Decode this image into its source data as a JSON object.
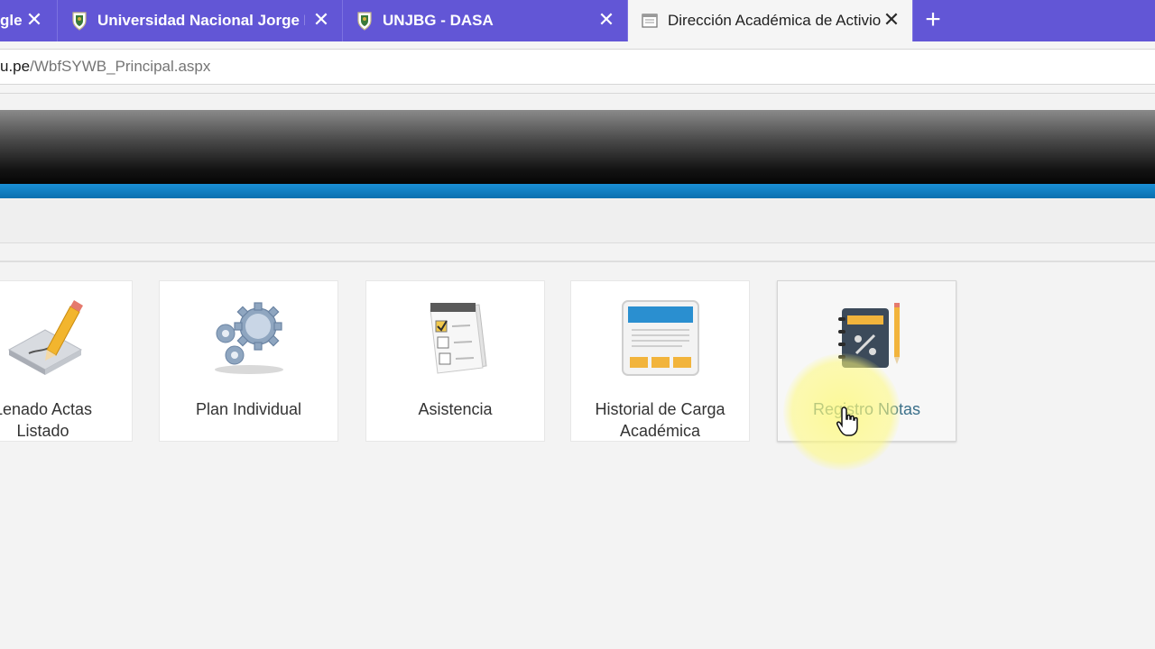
{
  "browser": {
    "tabs": [
      {
        "label": "gle",
        "favicon": "none",
        "active": false
      },
      {
        "label": "Universidad Nacional Jorge Bas",
        "favicon": "crest-icon",
        "active": false
      },
      {
        "label": "UNJBG - DASA",
        "favicon": "crest-icon",
        "active": false
      },
      {
        "label": "Dirección Académica de Activio",
        "favicon": "document-icon",
        "active": true
      }
    ],
    "new_tab_glyph": "+",
    "close_glyph": "✕",
    "url": {
      "host": "u.pe",
      "path": "/WbfSYWB_Principal.aspx"
    }
  },
  "tiles": [
    {
      "label_line1": "Lenado Actas",
      "label_line2": "Listado",
      "icon": "pencil-edit-icon"
    },
    {
      "label_line1": "Plan Individual",
      "label_line2": "",
      "icon": "gears-icon"
    },
    {
      "label_line1": "Asistencia",
      "label_line2": "",
      "icon": "checklist-calendar-icon"
    },
    {
      "label_line1": "Historial de Carga",
      "label_line2": "Académica",
      "icon": "document-window-icon"
    },
    {
      "label_line1": "Registro Notas",
      "label_line2": "",
      "icon": "gradebook-icon"
    }
  ],
  "colors": {
    "tab_strip": "#6256d6",
    "header_accent": "#1a8fd6",
    "page_bg": "#f3f3f3"
  }
}
